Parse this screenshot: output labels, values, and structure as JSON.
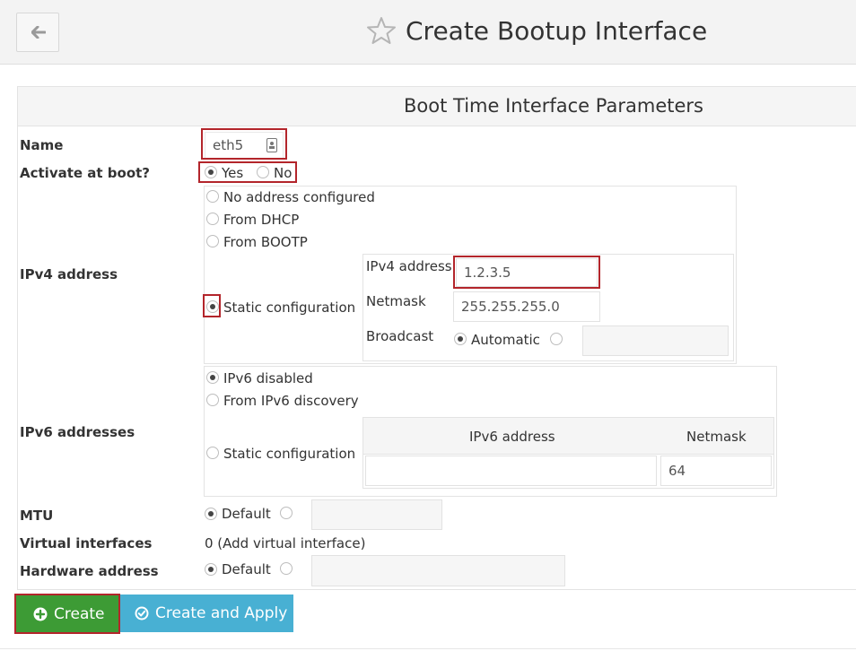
{
  "header": {
    "title": "Create Bootup Interface"
  },
  "panel": {
    "title": "Boot Time Interface Parameters"
  },
  "form": {
    "name": {
      "label": "Name",
      "value": "eth5"
    },
    "activate": {
      "label": "Activate at boot?",
      "yes": "Yes",
      "no": "No",
      "selected": "Yes"
    },
    "ipv4": {
      "label": "IPv4 address",
      "options": [
        "No address configured",
        "From DHCP",
        "From BOOTP",
        "Static configuration"
      ],
      "selected": "Static configuration",
      "static": {
        "address_label": "IPv4 address",
        "address_value": "1.2.3.5",
        "netmask_label": "Netmask",
        "netmask_value": "255.255.255.0",
        "broadcast_label": "Broadcast",
        "broadcast_auto": "Automatic",
        "broadcast_value": ""
      }
    },
    "ipv6": {
      "label": "IPv6 addresses",
      "options": [
        "IPv6 disabled",
        "From IPv6 discovery",
        "Static configuration"
      ],
      "selected": "IPv6 disabled",
      "table": {
        "col_address": "IPv6 address",
        "col_netmask": "Netmask",
        "address_value": "",
        "netmask_value": "64"
      }
    },
    "mtu": {
      "label": "MTU",
      "default": "Default",
      "value": ""
    },
    "virtual": {
      "label": "Virtual interfaces",
      "value": "0 (Add virtual interface)"
    },
    "hardware": {
      "label": "Hardware address",
      "default": "Default",
      "value": ""
    }
  },
  "buttons": {
    "create": "Create",
    "create_apply": "Create and Apply"
  },
  "colors": {
    "create_button": "#3d9b35",
    "apply_button": "#48b0d3",
    "highlight": "#b3252b"
  }
}
